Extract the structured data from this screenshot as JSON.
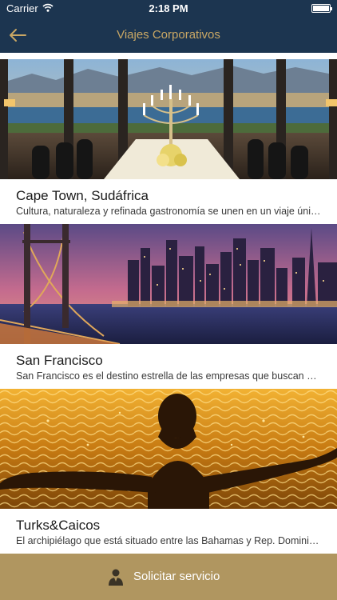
{
  "status_bar": {
    "carrier": "Carrier",
    "time": "2:18 PM"
  },
  "nav": {
    "title": "Viajes Corporativos",
    "back_icon": "arrow-left-icon"
  },
  "colors": {
    "nav_bg": "#1c3550",
    "accent": "#c9a764",
    "footer_bg": "#b09660"
  },
  "destinations": [
    {
      "name": "Cape Town, Sudáfrica",
      "description": "Cultura, naturaleza y refinada gastronomía se unen en un viaje único e inolvidable"
    },
    {
      "name": "San Francisco",
      "description": "San Francisco es el destino estrella de las empresas que buscan combinar negocios y ocio"
    },
    {
      "name": "Turks&Caicos",
      "description": "El archipiélago que está situado entre las Bahamas y Rep. Dominicana ofrece playas paradisíacas"
    }
  ],
  "footer": {
    "label": "Solicitar servicio",
    "icon": "person-icon"
  }
}
